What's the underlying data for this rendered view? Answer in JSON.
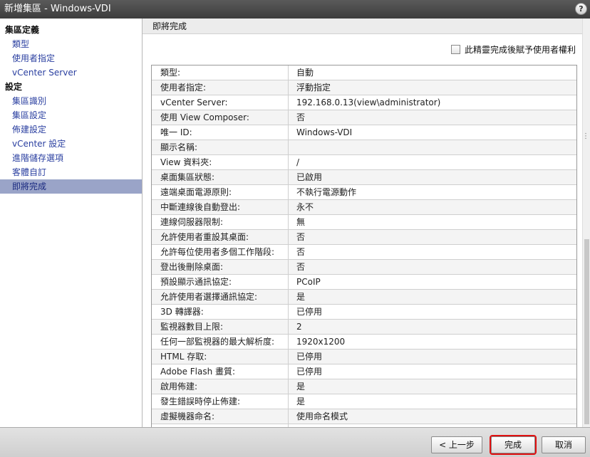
{
  "window": {
    "title": "新增集區 - Windows-VDI",
    "help_label": "?"
  },
  "sidebar": {
    "groups": [
      {
        "label": "集區定義",
        "items": [
          "類型",
          "使用者指定",
          "vCenter Server"
        ]
      },
      {
        "label": "設定",
        "items": [
          "集區識別",
          "集區設定",
          "佈建設定",
          "vCenter 設定",
          "進階儲存選項",
          "客體自訂",
          "即將完成"
        ]
      }
    ],
    "active_item": "即將完成"
  },
  "main": {
    "header": "即將完成",
    "checkbox_label": "此精靈完成後賦予使用者權利",
    "checkbox_checked": false,
    "summary": [
      {
        "key": "類型:",
        "value": "自動"
      },
      {
        "key": "使用者指定:",
        "value": "浮動指定"
      },
      {
        "key": "vCenter Server:",
        "value": "192.168.0.13(view\\administrator)"
      },
      {
        "key": "使用 View Composer:",
        "value": "否"
      },
      {
        "key": "唯一 ID:",
        "value": "Windows-VDI"
      },
      {
        "key": "顯示名稱:",
        "value": ""
      },
      {
        "key": "View 資料夾:",
        "value": "/"
      },
      {
        "key": "桌面集區狀態:",
        "value": "已啟用"
      },
      {
        "key": "遠端桌面電源原則:",
        "value": "不執行電源動作"
      },
      {
        "key": "中斷連線後自動登出:",
        "value": "永不"
      },
      {
        "key": "連線伺服器限制:",
        "value": "無"
      },
      {
        "key": "允許使用者重設其桌面:",
        "value": "否"
      },
      {
        "key": "允許每位使用者多個工作階段:",
        "value": "否"
      },
      {
        "key": "登出後刪除桌面:",
        "value": "否"
      },
      {
        "key": "預設顯示通訊協定:",
        "value": "PCoIP"
      },
      {
        "key": "允許使用者選擇通訊協定:",
        "value": "是"
      },
      {
        "key": "3D 轉譯器:",
        "value": "已停用"
      },
      {
        "key": "監視器數目上限:",
        "value": "2"
      },
      {
        "key": "任何一部監視器的最大解析度:",
        "value": "1920x1200"
      },
      {
        "key": "HTML 存取:",
        "value": "已停用"
      },
      {
        "key": "Adobe Flash 畫質:",
        "value": "已停用"
      },
      {
        "key": "啟用佈建:",
        "value": "是"
      },
      {
        "key": "發生錯誤時停止佈建:",
        "value": "是"
      },
      {
        "key": "虛擬機器命名:",
        "value": "使用命名模式"
      },
      {
        "key": "",
        "value": ""
      }
    ]
  },
  "footer": {
    "back_label": "< 上一步",
    "finish_label": "完成",
    "cancel_label": "取消"
  },
  "colors": {
    "highlight_outline": "#e01010",
    "active_item_bg": "#9aa4c8",
    "link_text": "#2a3fa0"
  }
}
